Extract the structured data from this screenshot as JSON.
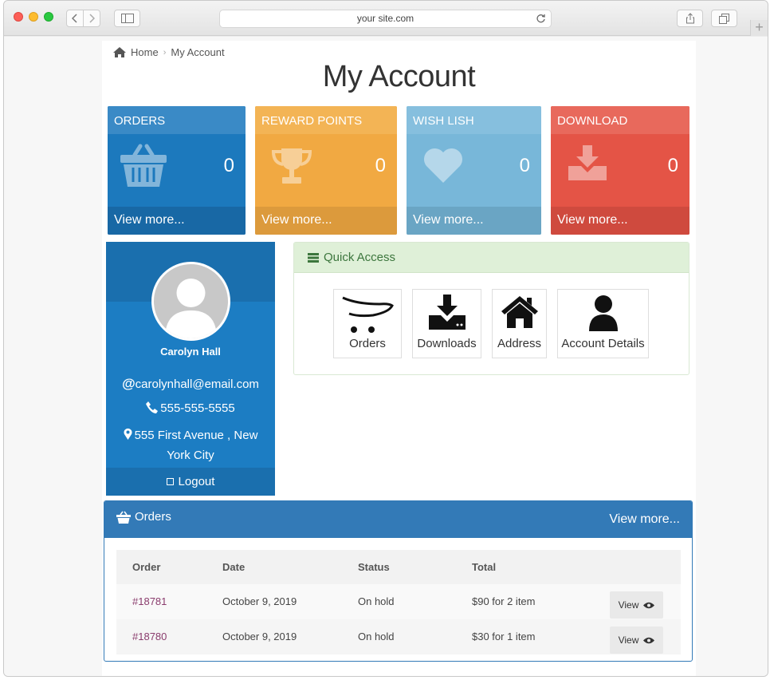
{
  "browser": {
    "url": "your site.com"
  },
  "breadcrumb": {
    "home": "Home",
    "current": "My Account"
  },
  "page": {
    "title": "My Account"
  },
  "cards": {
    "orders": {
      "title": "ORDERS",
      "count": "0",
      "more": "View more..."
    },
    "reward": {
      "title": "REWARD POINTS",
      "count": "0",
      "more": "View more..."
    },
    "wish": {
      "title": "WISH LISH",
      "count": "0",
      "more": "View more..."
    },
    "download": {
      "title": "DOWNLOAD",
      "count": "0",
      "more": "View more..."
    }
  },
  "profile": {
    "name": "Carolyn Hall",
    "email_at": "@",
    "email": "carolynhall@email.com",
    "phone": "555-555-5555",
    "address": "555 First Avenue , New York City",
    "logout": "Logout"
  },
  "quick_access": {
    "title": "Quick Access",
    "tiles": [
      "Orders",
      "Downloads",
      "Address",
      "Account Details"
    ]
  },
  "orders_panel": {
    "title": "Orders",
    "more": "View more...",
    "columns": [
      "Order",
      "Date",
      "Status",
      "Total"
    ],
    "rows": [
      {
        "order": "#18781",
        "date": "October 9, 2019",
        "status": "On hold",
        "total": "$90 for 2 item",
        "action": "View"
      },
      {
        "order": "#18780",
        "date": "October 9, 2019",
        "status": "On hold",
        "total": "$30 for 1 item",
        "action": "View"
      }
    ]
  },
  "colors": {
    "orders_card": "#1c79bd",
    "reward_card": "#f1a942",
    "wish_card": "#78b7d9",
    "download_card": "#e45446",
    "panel_primary": "#337ab7",
    "quick_access_head": "#dff0d8"
  },
  "icons": {
    "breadcrumb": "home-icon",
    "orders_card": "basket-icon",
    "reward_card": "trophy-icon",
    "wish_card": "heart-icon",
    "download_card": "download-icon",
    "quick_access": "list-icon",
    "orders_panel": "basket-icon",
    "view": "eye-icon"
  }
}
